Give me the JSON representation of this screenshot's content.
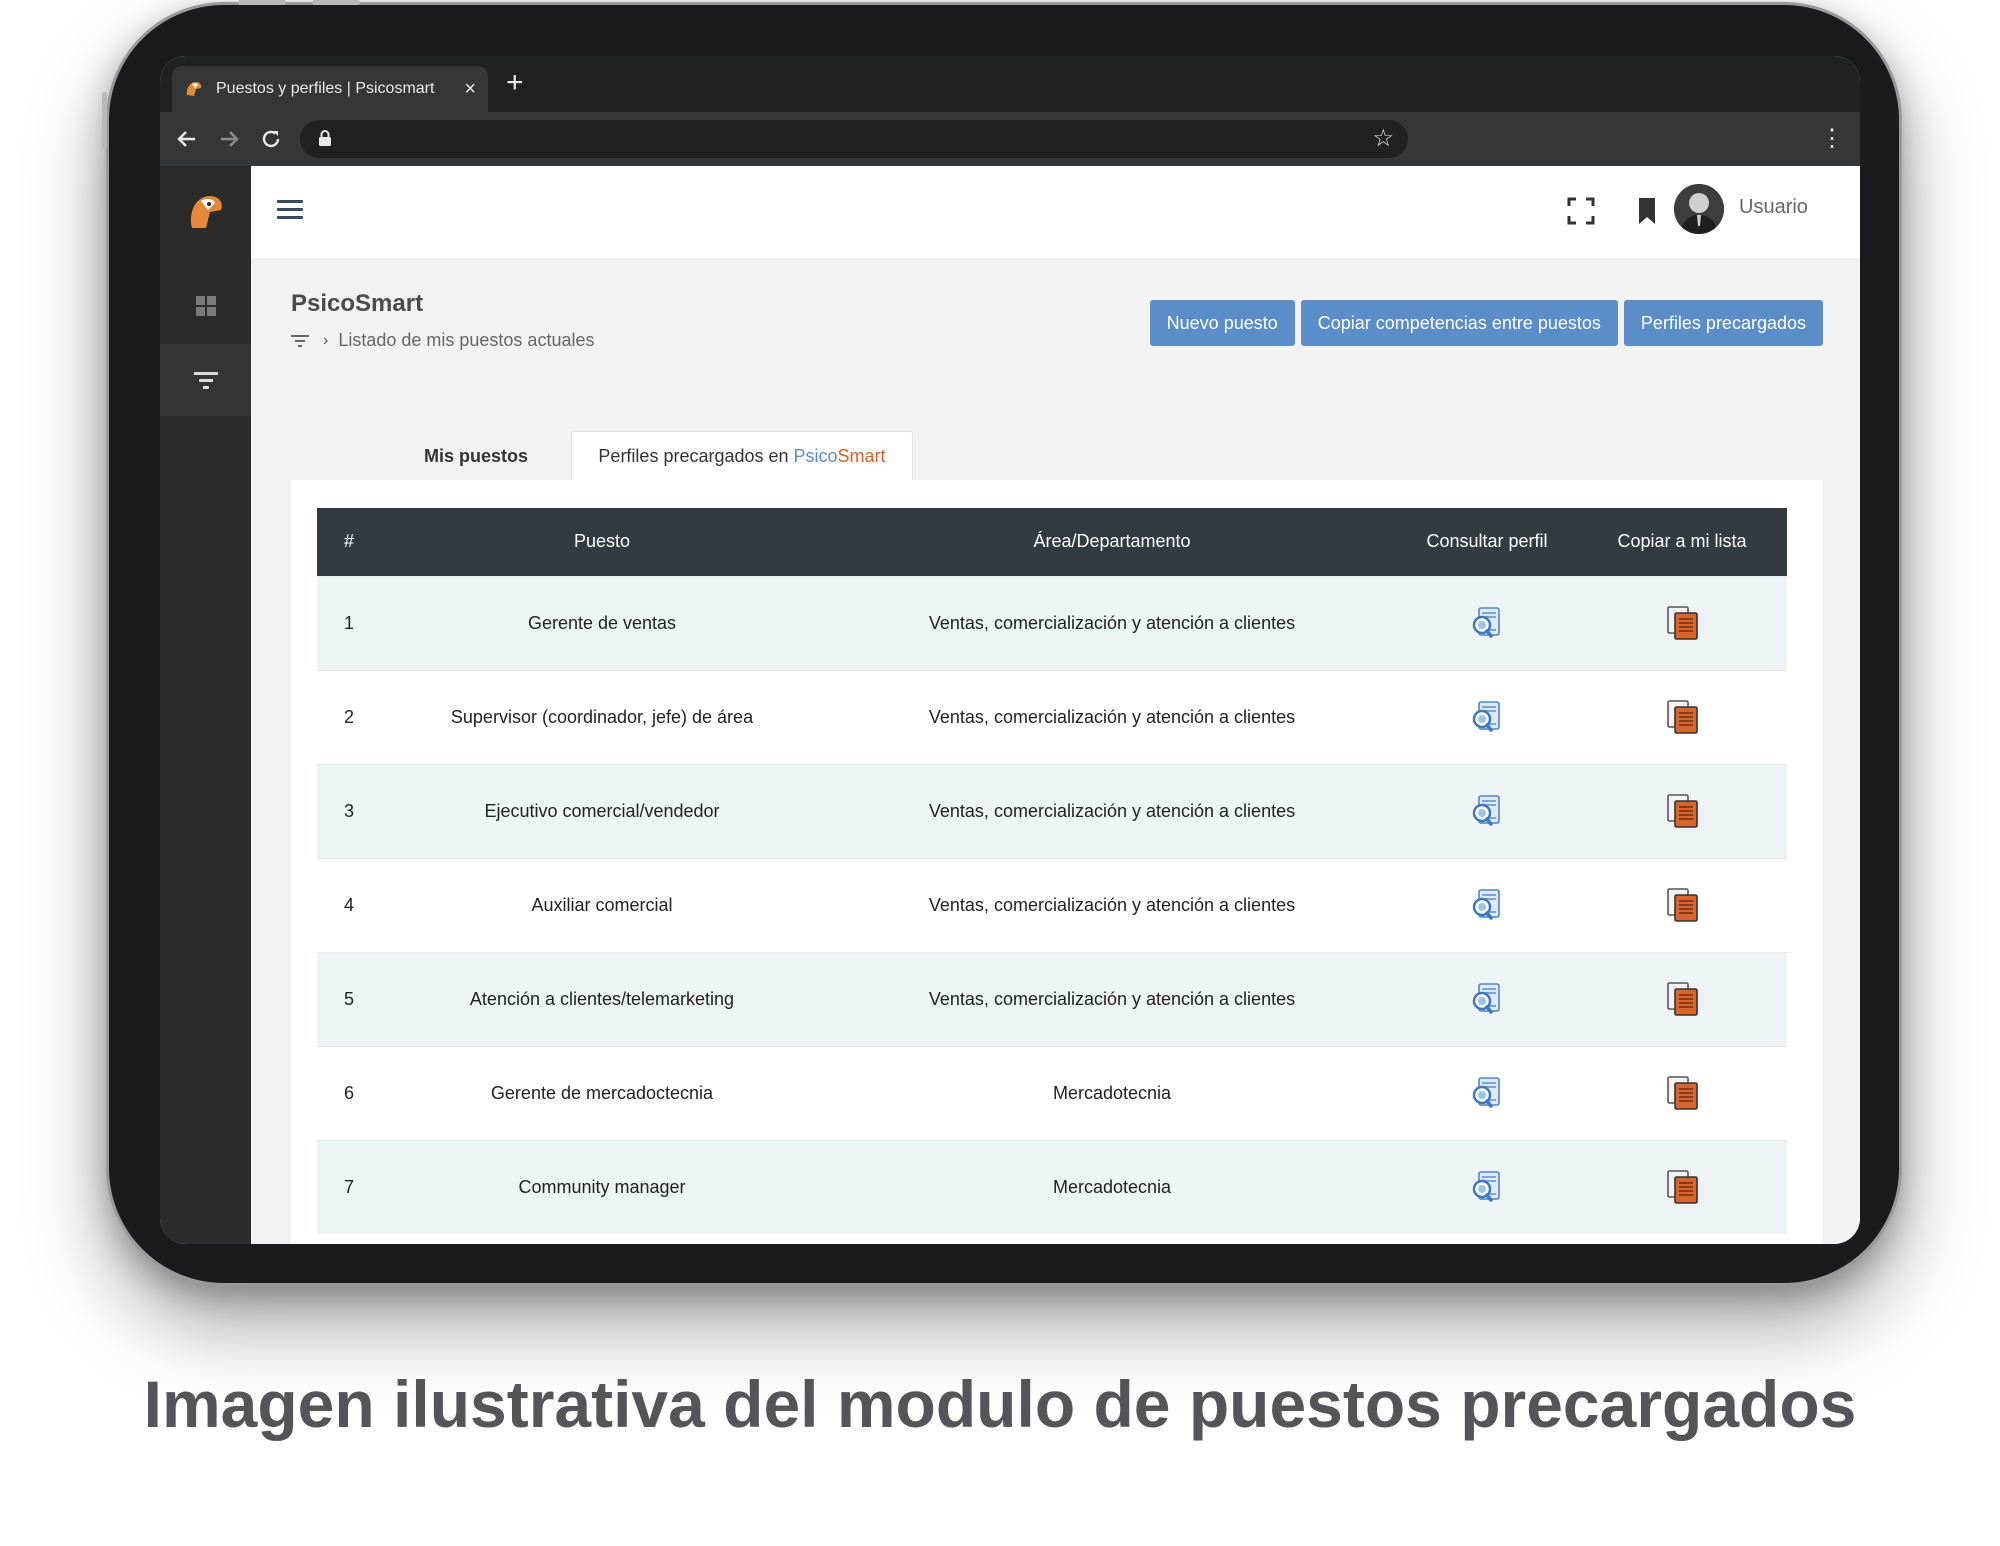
{
  "browser": {
    "tab_title": "Puestos y perfiles | Psicosmart",
    "close_glyph": "×",
    "new_tab_glyph": "+",
    "url": ""
  },
  "header": {
    "user_name": "Usuario"
  },
  "page": {
    "title": "PsicoSmart",
    "breadcrumb": "Listado de mis puestos actuales"
  },
  "actions": {
    "new_position": "Nuevo puesto",
    "copy_competencies": "Copiar competencias entre puestos",
    "preloaded_profiles": "Perfiles precargados"
  },
  "tabs": {
    "my_positions": "Mis puestos",
    "preloaded_prefix": "Perfiles precargados en",
    "brand_part1": "Psico",
    "brand_part2": "Smart"
  },
  "table": {
    "headers": [
      "#",
      "Puesto",
      "Área/Departamento",
      "Consultar perfil",
      "Copiar a mi lista"
    ],
    "rows": [
      {
        "num": "1",
        "position": "Gerente de ventas",
        "area": "Ventas, comercialización y atención a clientes"
      },
      {
        "num": "2",
        "position": "Supervisor (coordinador, jefe) de área",
        "area": "Ventas, comercialización y atención a clientes"
      },
      {
        "num": "3",
        "position": "Ejecutivo comercial/vendedor",
        "area": "Ventas, comercialización y atención a clientes"
      },
      {
        "num": "4",
        "position": "Auxiliar comercial",
        "area": "Ventas, comercialización y atención a clientes"
      },
      {
        "num": "5",
        "position": "Atención a clientes/telemarketing",
        "area": "Ventas, comercialización y atención a clientes"
      },
      {
        "num": "6",
        "position": "Gerente de mercadoctecnia",
        "area": "Mercadotecnia"
      },
      {
        "num": "7",
        "position": "Community manager",
        "area": "Mercadotecnia"
      }
    ]
  },
  "caption": "Imagen ilustrativa del modulo de puestos precargados",
  "colors": {
    "accent": "#5b8ec8",
    "brand_orange": "#d5622d",
    "table_header": "#343a40",
    "sidebar": "#2b2b2b"
  },
  "icons": {
    "view_profile": "document-search-icon",
    "copy_to_list": "copy-documents-icon"
  }
}
